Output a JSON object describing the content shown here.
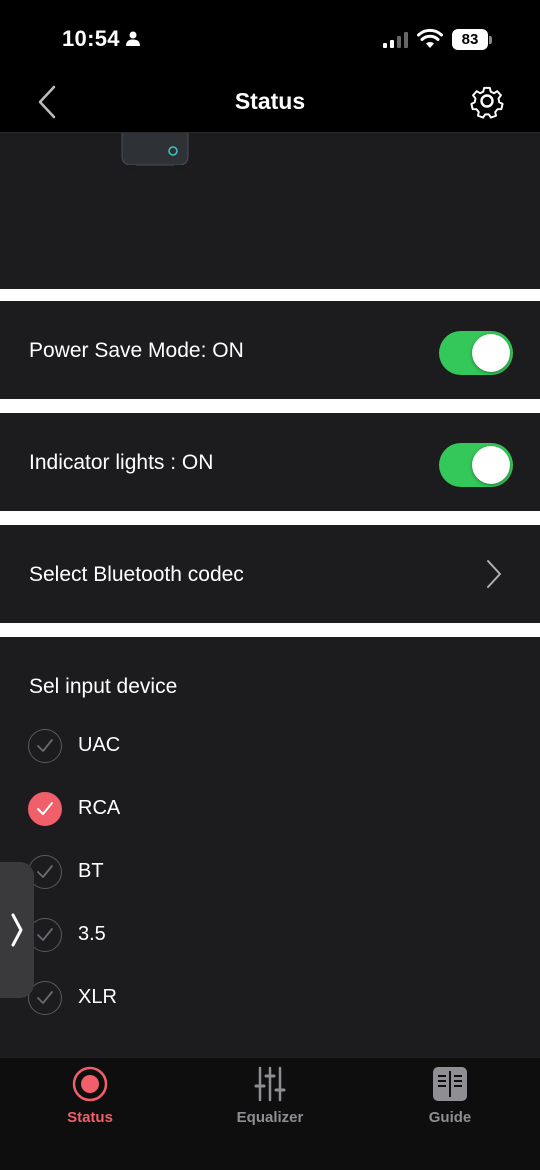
{
  "status_bar": {
    "time": "10:54",
    "battery": "83"
  },
  "nav": {
    "title": "Status"
  },
  "power_save": {
    "label": "Power Save Mode:  ON",
    "enabled": true
  },
  "indicator_lights": {
    "label": "Indicator lights : ON",
    "enabled": true
  },
  "bluetooth_codec": {
    "label": "Select Bluetooth codec"
  },
  "input_device": {
    "title": "Sel input device",
    "options": [
      {
        "label": "UAC",
        "selected": false
      },
      {
        "label": "RCA",
        "selected": true
      },
      {
        "label": "BT",
        "selected": false
      },
      {
        "label": "3.5",
        "selected": false
      },
      {
        "label": "XLR",
        "selected": false
      }
    ]
  },
  "tabs": [
    {
      "label": "Status",
      "icon": "record-icon",
      "active": true
    },
    {
      "label": "Equalizer",
      "icon": "sliders-icon",
      "active": false
    },
    {
      "label": "Guide",
      "icon": "book-icon",
      "active": false
    }
  ],
  "colors": {
    "accent": "#f05f6a",
    "toggle_on": "#34c759",
    "panel": "#1c1c1e"
  }
}
